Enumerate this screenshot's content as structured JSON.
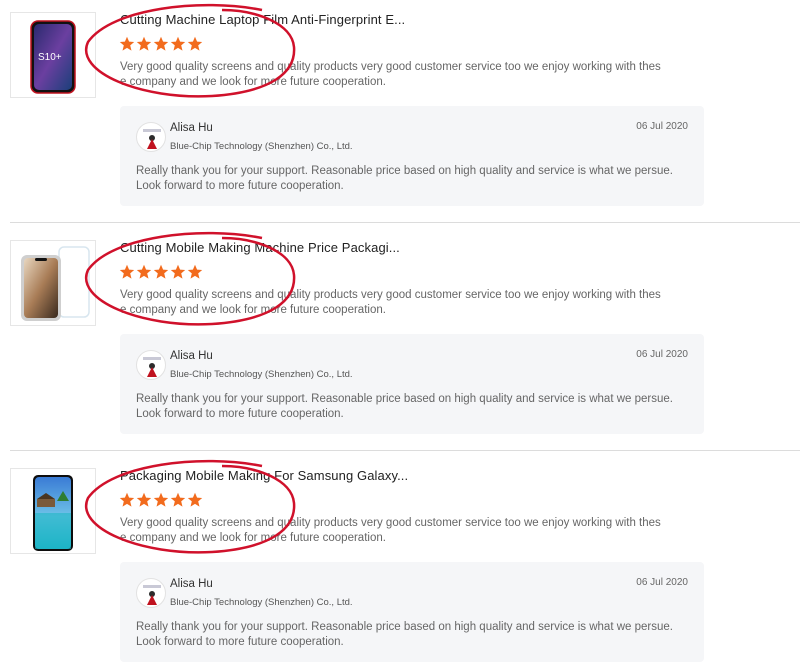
{
  "colors": {
    "star": "#f26b1d",
    "oval": "#d0112b",
    "reply_bg": "#f5f6f8",
    "divider": "#dcdcdc"
  },
  "reviews": [
    {
      "product_title": "Cutting Machine Laptop Film Anti-Fingerprint E...",
      "thumb_text": "S10+",
      "rating": 5,
      "text_line1": "Very good quality screens and quality products very good customer service too we enjoy working with thes",
      "text_line2": "e company and we look for more future cooperation.",
      "reply": {
        "name": "Alisa Hu",
        "company": "Blue-Chip Technology (Shenzhen) Co., Ltd.",
        "date": "06 Jul 2020",
        "text_line1": "Really thank you for your support. Reasonable price based on high quality and service is what we persue.",
        "text_line2": "Look forward to more future cooperation."
      }
    },
    {
      "product_title": "Cutting Mobile Making Machine Price Packagi...",
      "thumb_text": "",
      "rating": 5,
      "text_line1": "Very good quality screens and quality products very good customer service too we enjoy working with thes",
      "text_line2": "e company and we look for more future cooperation.",
      "reply": {
        "name": "Alisa Hu",
        "company": "Blue-Chip Technology (Shenzhen) Co., Ltd.",
        "date": "06 Jul 2020",
        "text_line1": "Really thank you for your support. Reasonable price based on high quality and service is what we persue.",
        "text_line2": "Look forward to more future cooperation."
      }
    },
    {
      "product_title": "Packaging Mobile Making For Samsung Galaxy...",
      "thumb_text": "",
      "rating": 5,
      "text_line1": "Very good quality screens and quality products very good customer service too we enjoy working with thes",
      "text_line2": "e company and we look for more future cooperation.",
      "reply": {
        "name": "Alisa Hu",
        "company": "Blue-Chip Technology (Shenzhen) Co., Ltd.",
        "date": "06 Jul 2020",
        "text_line1": "Really thank you for your support. Reasonable price based on high quality and service is what we persue.",
        "text_line2": "Look forward to more future cooperation."
      }
    }
  ]
}
